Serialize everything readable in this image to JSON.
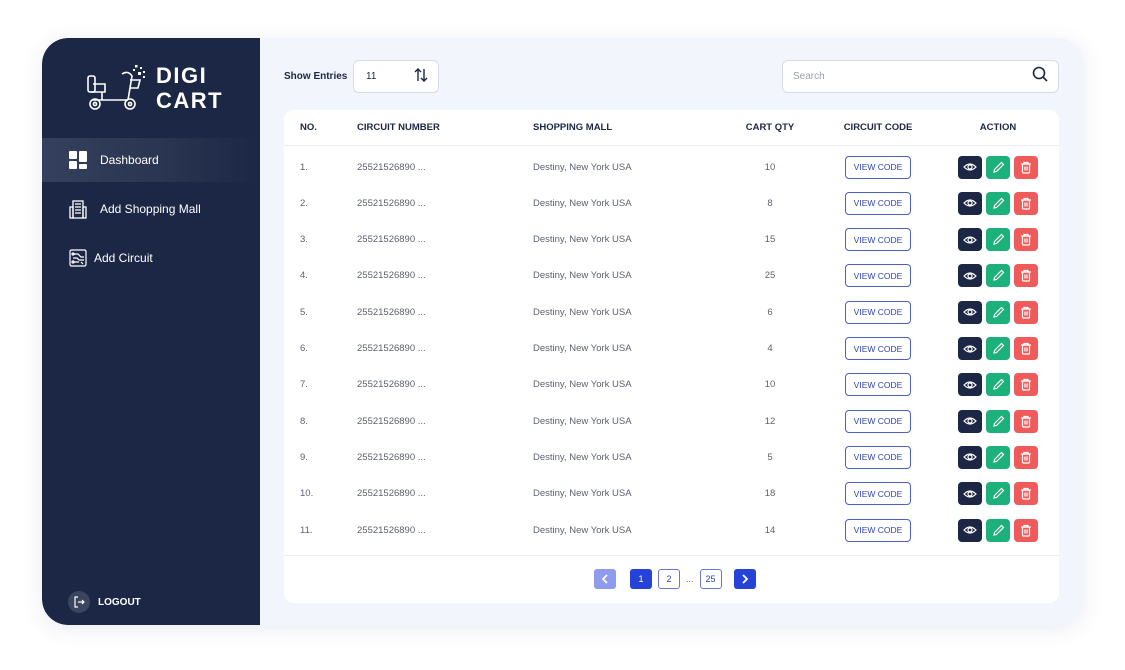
{
  "brand": {
    "line1": "DIGI",
    "line2": "CART"
  },
  "sidebar": {
    "items": [
      {
        "label": "Dashboard",
        "icon": "dashboard-icon",
        "active": true
      },
      {
        "label": "Add Shopping Mall",
        "icon": "building-icon",
        "active": false
      },
      {
        "label": "Add Circuit",
        "icon": "circuit-icon",
        "active": false
      }
    ],
    "logout_label": "LOGOUT"
  },
  "toolbar": {
    "show_entries_label": "Show Entries",
    "entries_value": "11",
    "search_placeholder": "Search",
    "search_value": ""
  },
  "table": {
    "headers": [
      "NO.",
      "CIRCUIT NUMBER",
      "SHOPPING MALL",
      "CART QTY",
      "CIRCUIT CODE",
      "ACTION"
    ],
    "view_code_label": "VIEW CODE",
    "rows": [
      {
        "no": "1.",
        "circuit": "25521526890 ...",
        "mall": "Destiny, New York USA",
        "qty": "10"
      },
      {
        "no": "2.",
        "circuit": "25521526890 ...",
        "mall": "Destiny, New York USA",
        "qty": "8"
      },
      {
        "no": "3.",
        "circuit": "25521526890 ...",
        "mall": "Destiny, New York USA",
        "qty": "15"
      },
      {
        "no": "4.",
        "circuit": "25521526890 ...",
        "mall": "Destiny, New York USA",
        "qty": "25"
      },
      {
        "no": "5.",
        "circuit": "25521526890 ...",
        "mall": "Destiny, New York USA",
        "qty": "6"
      },
      {
        "no": "6.",
        "circuit": "25521526890 ...",
        "mall": "Destiny, New York USA",
        "qty": "4"
      },
      {
        "no": "7.",
        "circuit": "25521526890 ...",
        "mall": "Destiny, New York USA",
        "qty": "10"
      },
      {
        "no": "8.",
        "circuit": "25521526890 ...",
        "mall": "Destiny, New York USA",
        "qty": "12"
      },
      {
        "no": "9.",
        "circuit": "25521526890 ...",
        "mall": "Destiny, New York USA",
        "qty": "5"
      },
      {
        "no": "10.",
        "circuit": "25521526890 ...",
        "mall": "Destiny, New York USA",
        "qty": "18"
      },
      {
        "no": "11.",
        "circuit": "25521526890 ...",
        "mall": "Destiny, New York USA",
        "qty": "14"
      }
    ]
  },
  "pagination": {
    "pages": [
      "1",
      "2",
      "25"
    ],
    "current": "1",
    "ellipsis": "..."
  },
  "colors": {
    "sidebar_bg": "#1b2745",
    "accent_blue": "#2643d8",
    "view_btn": "#1b2745",
    "edit_btn": "#1cb07a",
    "delete_btn": "#ef5b5b"
  }
}
